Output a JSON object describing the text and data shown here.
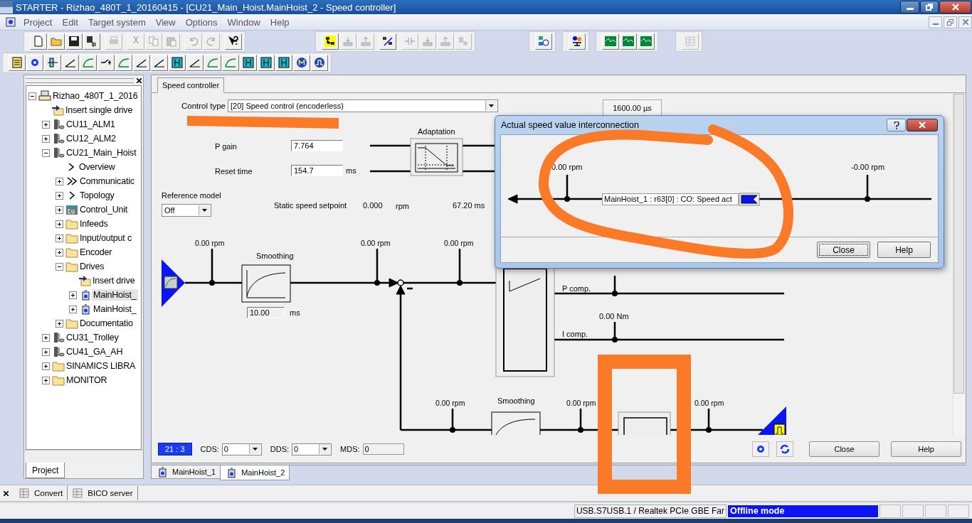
{
  "window": {
    "title": "STARTER - Rizhao_480T_1_20160415 - [CU21_Main_Hoist.MainHoist_2 - Speed controller]"
  },
  "menu": [
    "Project",
    "Edit",
    "Target system",
    "View",
    "Options",
    "Window",
    "Help"
  ],
  "toolbars": [
    {
      "buttons": [
        {
          "disabled": false
        },
        {
          "disabled": false
        },
        {
          "disabled": false
        },
        {
          "disabled": false
        },
        {
          "disabled": true
        },
        {
          "disabled": true
        },
        {
          "disabled": true
        },
        {
          "disabled": true
        },
        {
          "disabled": true
        },
        {
          "disabled": true
        },
        {
          "disabled": false
        }
      ]
    },
    {
      "buttons": [
        {
          "disabled": false
        },
        {
          "disabled": true
        },
        {
          "disabled": true
        },
        {
          "disabled": false
        },
        {
          "disabled": true
        },
        {
          "disabled": true
        },
        {
          "disabled": true
        },
        {
          "disabled": true
        }
      ]
    },
    {
      "buttons": [
        {
          "disabled": false
        }
      ]
    },
    {
      "buttons": [
        {
          "disabled": false
        }
      ]
    },
    {
      "buttons": [
        {
          "disabled": false
        },
        {
          "disabled": false
        },
        {
          "disabled": false
        }
      ]
    },
    {
      "buttons": [
        {
          "disabled": true
        }
      ]
    },
    {
      "buttons": [
        {
          "disabled": false
        },
        {
          "disabled": false
        },
        {
          "disabled": false
        },
        {
          "disabled": false
        },
        {
          "disabled": false
        },
        {
          "disabled": false
        },
        {
          "disabled": false
        },
        {
          "disabled": false
        },
        {
          "disabled": false
        },
        {
          "disabled": false
        },
        {
          "disabled": false
        },
        {
          "disabled": false
        },
        {
          "disabled": false
        },
        {
          "disabled": false
        },
        {
          "disabled": false
        },
        {
          "disabled": false
        },
        {
          "disabled": false
        },
        {
          "disabled": false
        }
      ]
    }
  ],
  "project_tree": [
    {
      "label": "Rizhao_480T_1_2016",
      "kind": "project",
      "expanded": true,
      "selected": false,
      "children": [
        {
          "label": "Insert single drive",
          "kind": "insert",
          "selected": false
        },
        {
          "label": "CU11_ALM1",
          "kind": "device",
          "expanded": false,
          "selected": false
        },
        {
          "label": "CU12_ALM2",
          "kind": "device",
          "expanded": false,
          "selected": false
        },
        {
          "label": "CU21_Main_Hoist",
          "kind": "device",
          "expanded": true,
          "selected": false,
          "children": [
            {
              "label": "Overview",
              "kind": "arrow",
              "selected": false
            },
            {
              "label": "Communicatic",
              "kind": "double-arrow",
              "expanded": false,
              "selected": false
            },
            {
              "label": "Topology",
              "kind": "arrow",
              "expanded": false,
              "selected": false
            },
            {
              "label": "Control_Unit",
              "kind": "cu",
              "expanded": false,
              "selected": false
            },
            {
              "label": "Infeeds",
              "kind": "folder",
              "expanded": false,
              "selected": false
            },
            {
              "label": "Input/output c",
              "kind": "folder",
              "expanded": false,
              "selected": false
            },
            {
              "label": "Encoder",
              "kind": "folder",
              "expanded": false,
              "selected": false
            },
            {
              "label": "Drives",
              "kind": "folder",
              "expanded": true,
              "selected": false,
              "children": [
                {
                  "label": "Insert drive",
                  "kind": "insert",
                  "selected": false
                },
                {
                  "label": "MainHoist_",
                  "kind": "drive",
                  "expanded": false,
                  "selected": true
                },
                {
                  "label": "MainHoist_",
                  "kind": "drive",
                  "expanded": false,
                  "selected": false
                }
              ]
            },
            {
              "label": "Documentatio",
              "kind": "folder",
              "expanded": false,
              "selected": false
            }
          ]
        },
        {
          "label": "CU31_Trolley",
          "kind": "device",
          "expanded": false,
          "selected": false
        },
        {
          "label": "CU41_GA_AH",
          "kind": "device",
          "expanded": false,
          "selected": false
        },
        {
          "label": "SINAMICS LIBRA",
          "kind": "folder",
          "expanded": false,
          "selected": false
        },
        {
          "label": "MONITOR",
          "kind": "folder",
          "expanded": false,
          "selected": false
        }
      ]
    }
  ],
  "project_panel_tab": "Project",
  "editor": {
    "tabs": [
      {
        "label": "Speed controller",
        "selected": true
      }
    ],
    "control_type_label": "Control type",
    "control_type_value": "[20] Speed control (encoderless)",
    "sample_time": "1600.00 µs",
    "p_gain_label": "P gain",
    "p_gain_value": "7.764",
    "reset_time_label": "Reset time",
    "reset_time_value": "154.7",
    "reset_time_unit": "ms",
    "adaptation_label": "Adaptation",
    "reference_model_label": "Reference model",
    "reference_model_value": "Off",
    "static_setpoint_label": "Static speed setpoint",
    "static_setpoint_value": "0.000",
    "static_setpoint_unit": "rpm",
    "time_value": "67.20 ms",
    "readings": [
      "0.00 rpm",
      "0.00 rpm",
      "0.00 rpm",
      "0.00 rpm",
      "0.00 rpm",
      "0.00 rpm"
    ],
    "smoothing_label": "Smoothing",
    "smoothing_time": "10.00",
    "smoothing_unit": "ms",
    "p_comp_label": "P comp.",
    "i_comp_label": "I comp.",
    "torque_reading": "0.00 Nm",
    "feedback_smoothing_label": "Smoothing",
    "drive_object_number": "21 : 3",
    "cds_label": "CDS:",
    "cds_value": "0",
    "dds_label": "DDS:",
    "dds_value": "0",
    "mds_label": "MDS:",
    "mds_value": "0",
    "buttons": [
      "Close",
      "Help"
    ]
  },
  "document_tabs": [
    {
      "label": "MainHoist_1",
      "selected": false
    },
    {
      "label": "MainHoist_2",
      "selected": true
    }
  ],
  "dialog": {
    "title": "Actual speed value interconnection",
    "left_reading": "0.00 rpm",
    "right_reading": "-0.00 rpm",
    "connector": "MainHoist_1 : r63[0] : CO: Speed act",
    "buttons": [
      "Close",
      "Help"
    ]
  },
  "bottom_tabs": [
    {
      "label": "Convert",
      "selected": false
    },
    {
      "label": "BICO server",
      "selected": false
    }
  ],
  "status_bar": {
    "connection": "USB.S7USB.1 / Realtek PCIe GBE Far",
    "mode": "Offline mode"
  }
}
